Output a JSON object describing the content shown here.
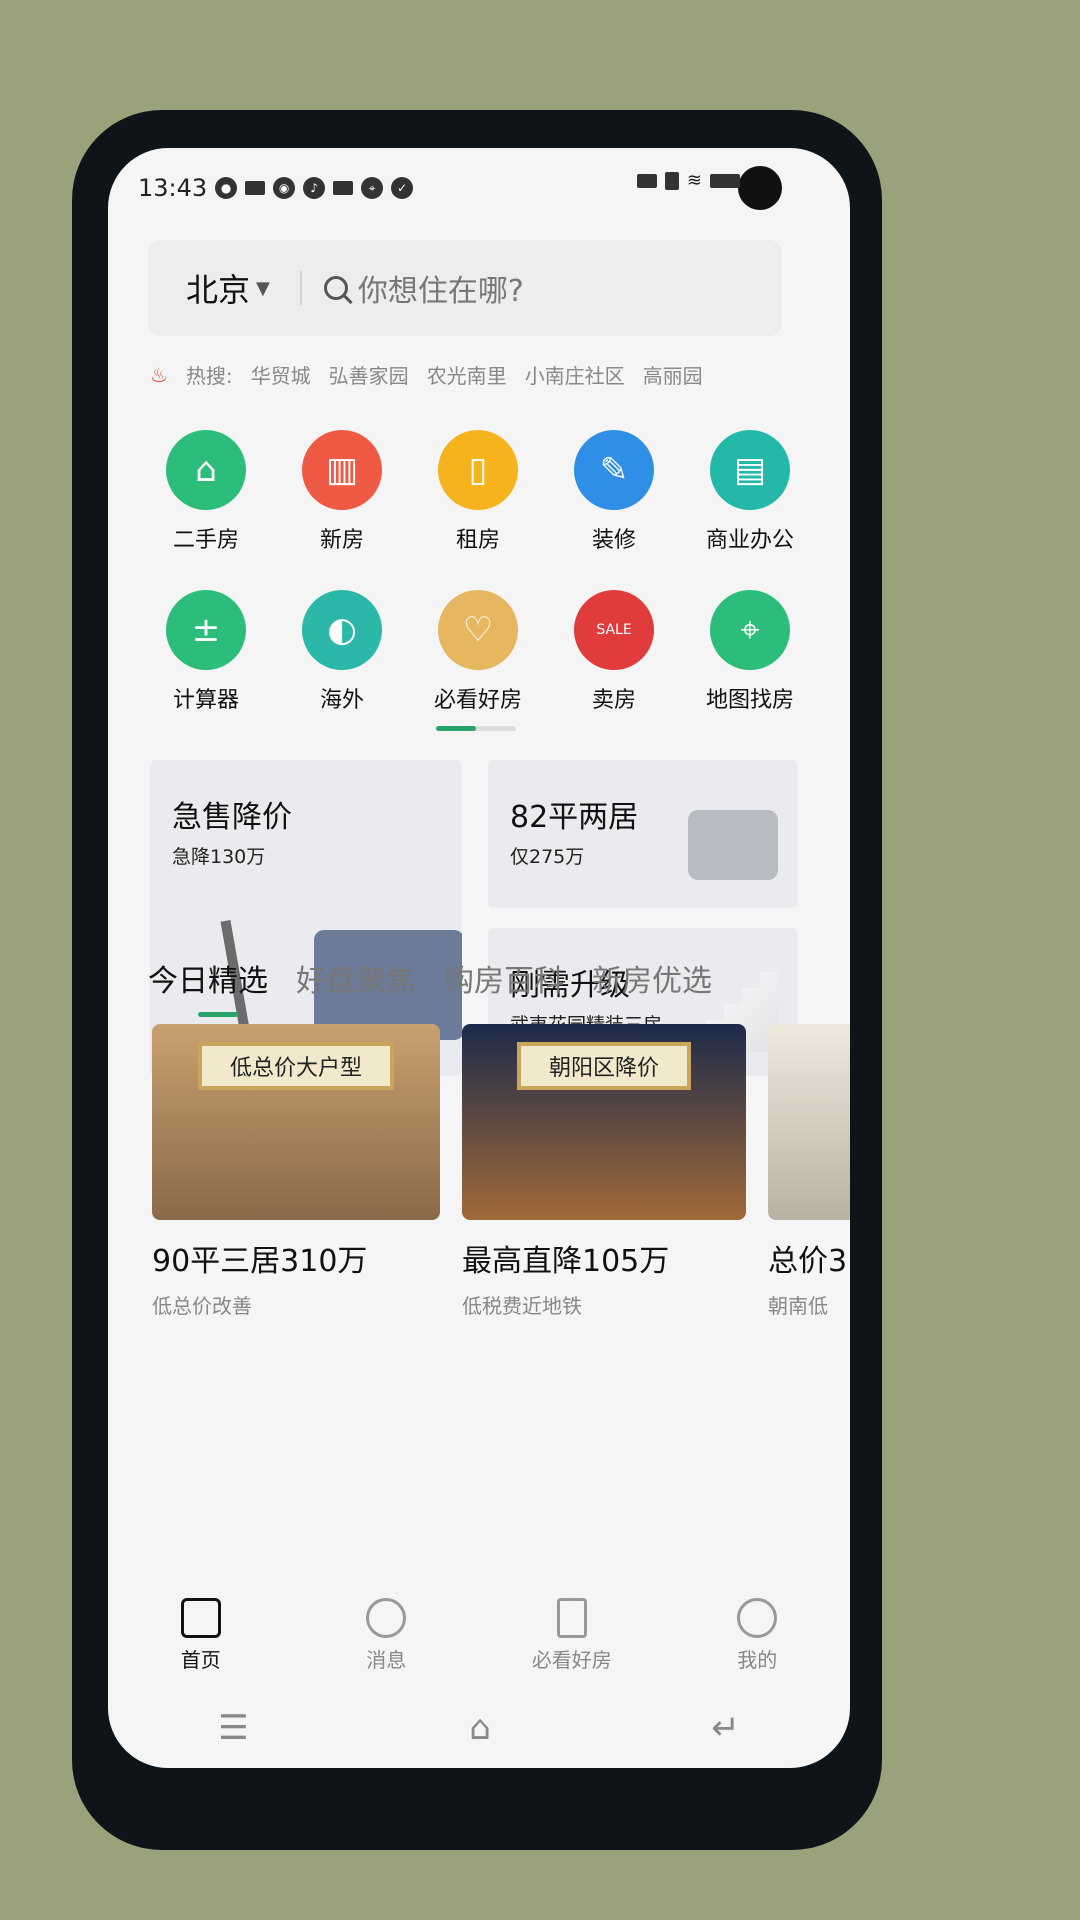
{
  "status_bar": {
    "time": "13:43"
  },
  "header": {
    "city": "北京",
    "search_placeholder": "你想住在哪?"
  },
  "hot_search": {
    "label": "热搜:",
    "items": [
      "华贸城",
      "弘善家园",
      "农光南里",
      "小南庄社区",
      "高丽园"
    ]
  },
  "categories": [
    {
      "label": "二手房",
      "icon": "home-icon",
      "color": "#2dbd7a"
    },
    {
      "label": "新房",
      "icon": "building-icon",
      "color": "#ef5a44"
    },
    {
      "label": "租房",
      "icon": "door-icon",
      "color": "#f5b41e"
    },
    {
      "label": "装修",
      "icon": "brush-icon",
      "color": "#2f8ee6"
    },
    {
      "label": "商业办公",
      "icon": "shop-icon",
      "color": "#24b8a8"
    },
    {
      "label": "计算器",
      "icon": "calculator-icon",
      "color": "#2dbd7a"
    },
    {
      "label": "海外",
      "icon": "globe-icon",
      "color": "#2bb8a8"
    },
    {
      "label": "必看好房",
      "icon": "house-heart-icon",
      "color": "#e6b660"
    },
    {
      "label": "卖房",
      "icon": "sale-tag-icon",
      "color": "#e03c3c"
    },
    {
      "label": "地图找房",
      "icon": "map-pin-icon",
      "color": "#2dbd7a"
    }
  ],
  "promos": [
    {
      "title": "急售降价",
      "subtitle": "急降130万"
    },
    {
      "title": "82平两居",
      "subtitle": "仅275万"
    },
    {
      "title": "刚需升级",
      "subtitle": "武夷花园精装三房"
    }
  ],
  "tabs": [
    "今日精选",
    "好盘聚焦",
    "购房百科",
    "新房优选"
  ],
  "listings": [
    {
      "banner": "低总价大户型",
      "title": "90平三居310万",
      "subtitle": "低总价改善"
    },
    {
      "banner": "朝阳区降价",
      "title": "最高直降105万",
      "subtitle": "低税费近地铁"
    },
    {
      "banner": "",
      "title": "总价3",
      "subtitle": "朝南低"
    }
  ],
  "bottom_nav": [
    "首页",
    "消息",
    "必看好房",
    "我的"
  ]
}
